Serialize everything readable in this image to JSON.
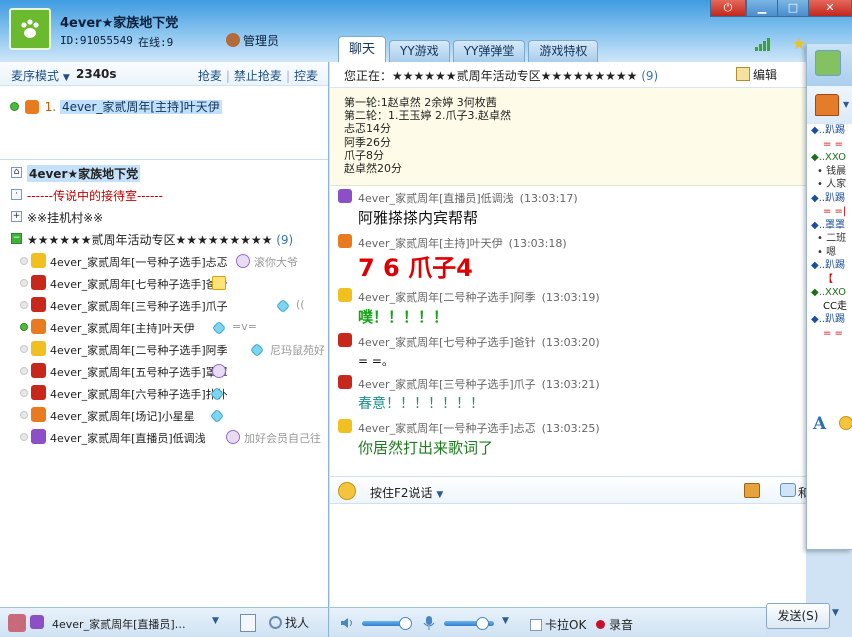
{
  "header": {
    "room_title": "4ever★家族地下党",
    "room_id": "ID:91055549",
    "online": "在线:9",
    "admin_label": "管理员",
    "tabs": [
      {
        "label": "聊天",
        "active": true
      },
      {
        "label": "YY游戏",
        "active": false
      },
      {
        "label": "YY弹弹堂",
        "active": false
      },
      {
        "label": "游戏特权",
        "active": false
      }
    ]
  },
  "mic": {
    "mode": "麦序模式",
    "time": "2340s",
    "actions": [
      "抢麦",
      "禁止抢麦",
      "控麦"
    ],
    "queue": [
      {
        "index": "1.",
        "name": "4ever_家贰周年[主持]叶天伊"
      }
    ]
  },
  "tree": {
    "root": "4ever★家族地下党",
    "waiting": "------传说中的接待室------",
    "hangout": "※※挂机村※※",
    "active_channel": "★★★★★★贰周年活动专区★★★★★★★★★",
    "active_count": "(9)",
    "members": [
      {
        "name": "4ever_家贰周年[一号种子选手]忐忑",
        "signature": "滚你大爷",
        "color": "#f0c020",
        "online": false,
        "badge": "purple"
      },
      {
        "name": "4ever_家贰周年[七号种子选手]爸针",
        "signature": "",
        "color": "#c8281c",
        "online": false,
        "badge": "crown"
      },
      {
        "name": "4ever_家贰周年[三号种子选手]爪子",
        "signature": "((",
        "color": "#c8281c",
        "online": false,
        "badge": "diamond"
      },
      {
        "name": "4ever_家贰周年[主持]叶天伊",
        "signature": "=v=",
        "color": "#e87a20",
        "online": true,
        "badge": "diamond"
      },
      {
        "name": "4ever_家贰周年[二号种子选手]阿季",
        "signature": "尼玛鼠苑好",
        "color": "#f0c020",
        "online": false,
        "badge": "diamond"
      },
      {
        "name": "4ever_家贰周年[五号种子选手]罩罩",
        "signature": "",
        "color": "#c8281c",
        "online": false,
        "badge": "purple"
      },
      {
        "name": "4ever_家贰周年[六号种子选手]扑扑",
        "signature": "",
        "color": "#c8281c",
        "online": false,
        "badge": "diamond"
      },
      {
        "name": "4ever_家贰周年[场记]小星星",
        "signature": "",
        "color": "#e87a20",
        "online": false,
        "badge": "diamond"
      },
      {
        "name": "4ever_家贰周年[直播员]低调浅",
        "signature": "加好会员自己往",
        "color": "#8d4fc6",
        "online": false,
        "badge": "purple"
      }
    ]
  },
  "self": {
    "name": "4ever_家贰周年[直播员]…",
    "find_label": "找人"
  },
  "center": {
    "location_label": "您正在：",
    "location_channel": "★★★★★★贰周年活动专区★★★★★★★★★",
    "location_count": "(9)",
    "edit_label": "编辑",
    "announcement": "第一轮:1赵卓然 2余婷 3何枚茜\n第二轮：1.王玉婷 2.爪子3.赵卓然\n忐忑14分\n阿季26分\n爪子8分\n赵卓然20分",
    "messages": [
      {
        "sender": "4ever_家贰周年[直播员]低调浅",
        "time": "(13:03:17)",
        "text": "阿雅搽搽内宾帮帮",
        "color": "#8d4fc6",
        "text_color": "#111111",
        "size": "15px",
        "bold": false
      },
      {
        "sender": "4ever_家贰周年[主持]叶天伊",
        "time": "(13:03:18)",
        "text": "7 6 爪子4",
        "color": "#e87a20",
        "text_color": "#dd0000",
        "size": "24px",
        "bold": true
      },
      {
        "sender": "4ever_家贰周年[二号种子选手]阿季",
        "time": "(13:03:19)",
        "text": "噗！！！！！",
        "color": "#f0c020",
        "text_color": "#17a317",
        "size": "15px",
        "bold": true
      },
      {
        "sender": "4ever_家贰周年[七号种子选手]爸针",
        "time": "(13:03:20)",
        "text": "= =。",
        "color": "#c8281c",
        "text_color": "#111111",
        "size": "12px",
        "bold": false
      },
      {
        "sender": "4ever_家贰周年[三号种子选手]爪子",
        "time": "(13:03:21)",
        "text": "春意！！！！！！！",
        "color": "#c8281c",
        "text_color": "#1a8f8f",
        "size": "14px",
        "bold": false
      },
      {
        "sender": "4ever_家贰周年[一号种子选手]忐忑",
        "time": "(13:03:25)",
        "text": "你居然打出来歌词了",
        "color": "#f0c020",
        "text_color": "#1c7d1c",
        "size": "15px",
        "bold": false
      }
    ],
    "ptt_label": "按住F2说话",
    "more_label": "和"
  },
  "bottom": {
    "karaoke_label": "卡拉OK",
    "record_label": "录音",
    "send_label": "发送(S)",
    "speaker_volume": 0.85,
    "mic_volume": 0.75
  },
  "right_panel": {
    "rows": [
      {
        "text": "◆..趴踢",
        "cls": "blue"
      },
      {
        "text": "= =",
        "cls": "red"
      },
      {
        "text": "◆..XXO",
        "cls": "green"
      },
      {
        "text": "• 钱晨",
        "cls": "gray"
      },
      {
        "text": "• 人家",
        "cls": "gray"
      },
      {
        "text": "◆..趴踢",
        "cls": "blue"
      },
      {
        "text": "= =|",
        "cls": "red"
      },
      {
        "text": "◆..罩罩",
        "cls": "blue"
      },
      {
        "text": "• 二班",
        "cls": "gray"
      },
      {
        "text": "• 嗯",
        "cls": "gray"
      },
      {
        "text": "◆..趴踢",
        "cls": "blue"
      },
      {
        "text": "【",
        "cls": "red"
      },
      {
        "text": "◆..XXO",
        "cls": "green"
      },
      {
        "text": "CC走",
        "cls": "black"
      },
      {
        "text": "◆..趴踢",
        "cls": "blue"
      },
      {
        "text": "= =",
        "cls": "red"
      }
    ]
  },
  "colors": {
    "header_blue": "#3f9be0",
    "logo_green": "#6ab92e",
    "highlight": "#bfe0ff",
    "red_text": "#dd0000"
  }
}
